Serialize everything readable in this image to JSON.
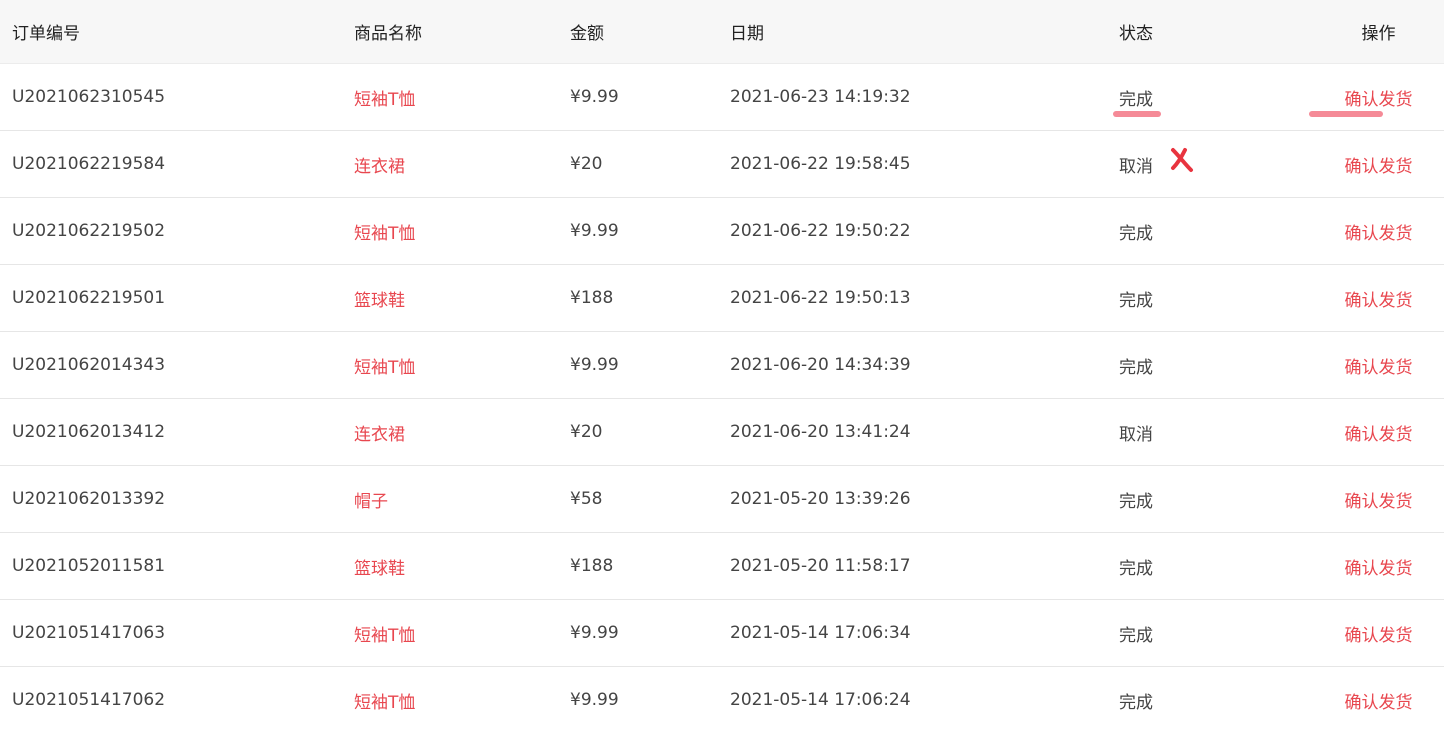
{
  "headers": {
    "order_no": "订单编号",
    "product_name": "商品名称",
    "amount": "金额",
    "date": "日期",
    "status": "状态",
    "action": "操作"
  },
  "rows": [
    {
      "order_no": "U2021062310545",
      "product_name": "短袖T恤",
      "amount": "¥9.99",
      "date": "2021-06-23 14:19:32",
      "status": "完成",
      "action": "确认发货"
    },
    {
      "order_no": "U2021062219584",
      "product_name": "连衣裙",
      "amount": "¥20",
      "date": "2021-06-22 19:58:45",
      "status": "取消",
      "action": "确认发货"
    },
    {
      "order_no": "U2021062219502",
      "product_name": "短袖T恤",
      "amount": "¥9.99",
      "date": "2021-06-22 19:50:22",
      "status": "完成",
      "action": "确认发货"
    },
    {
      "order_no": "U2021062219501",
      "product_name": "篮球鞋",
      "amount": "¥188",
      "date": "2021-06-22 19:50:13",
      "status": "完成",
      "action": "确认发货"
    },
    {
      "order_no": "U2021062014343",
      "product_name": "短袖T恤",
      "amount": "¥9.99",
      "date": "2021-06-20 14:34:39",
      "status": "完成",
      "action": "确认发货"
    },
    {
      "order_no": "U2021062013412",
      "product_name": "连衣裙",
      "amount": "¥20",
      "date": "2021-06-20 13:41:24",
      "status": "取消",
      "action": "确认发货"
    },
    {
      "order_no": "U2021062013392",
      "product_name": "帽子",
      "amount": "¥58",
      "date": "2021-05-20 13:39:26",
      "status": "完成",
      "action": "确认发货"
    },
    {
      "order_no": "U2021052011581",
      "product_name": "篮球鞋",
      "amount": "¥188",
      "date": "2021-05-20 11:58:17",
      "status": "完成",
      "action": "确认发货"
    },
    {
      "order_no": "U2021051417063",
      "product_name": "短袖T恤",
      "amount": "¥9.99",
      "date": "2021-05-14 17:06:34",
      "status": "完成",
      "action": "确认发货"
    },
    {
      "order_no": "U2021051417062",
      "product_name": "短袖T恤",
      "amount": "¥9.99",
      "date": "2021-05-14 17:06:24",
      "status": "完成",
      "action": "确认发货"
    }
  ],
  "colors": {
    "accent": "#e8474f",
    "annotation_underline": "#f58a97",
    "header_bg": "#f7f7f7"
  }
}
